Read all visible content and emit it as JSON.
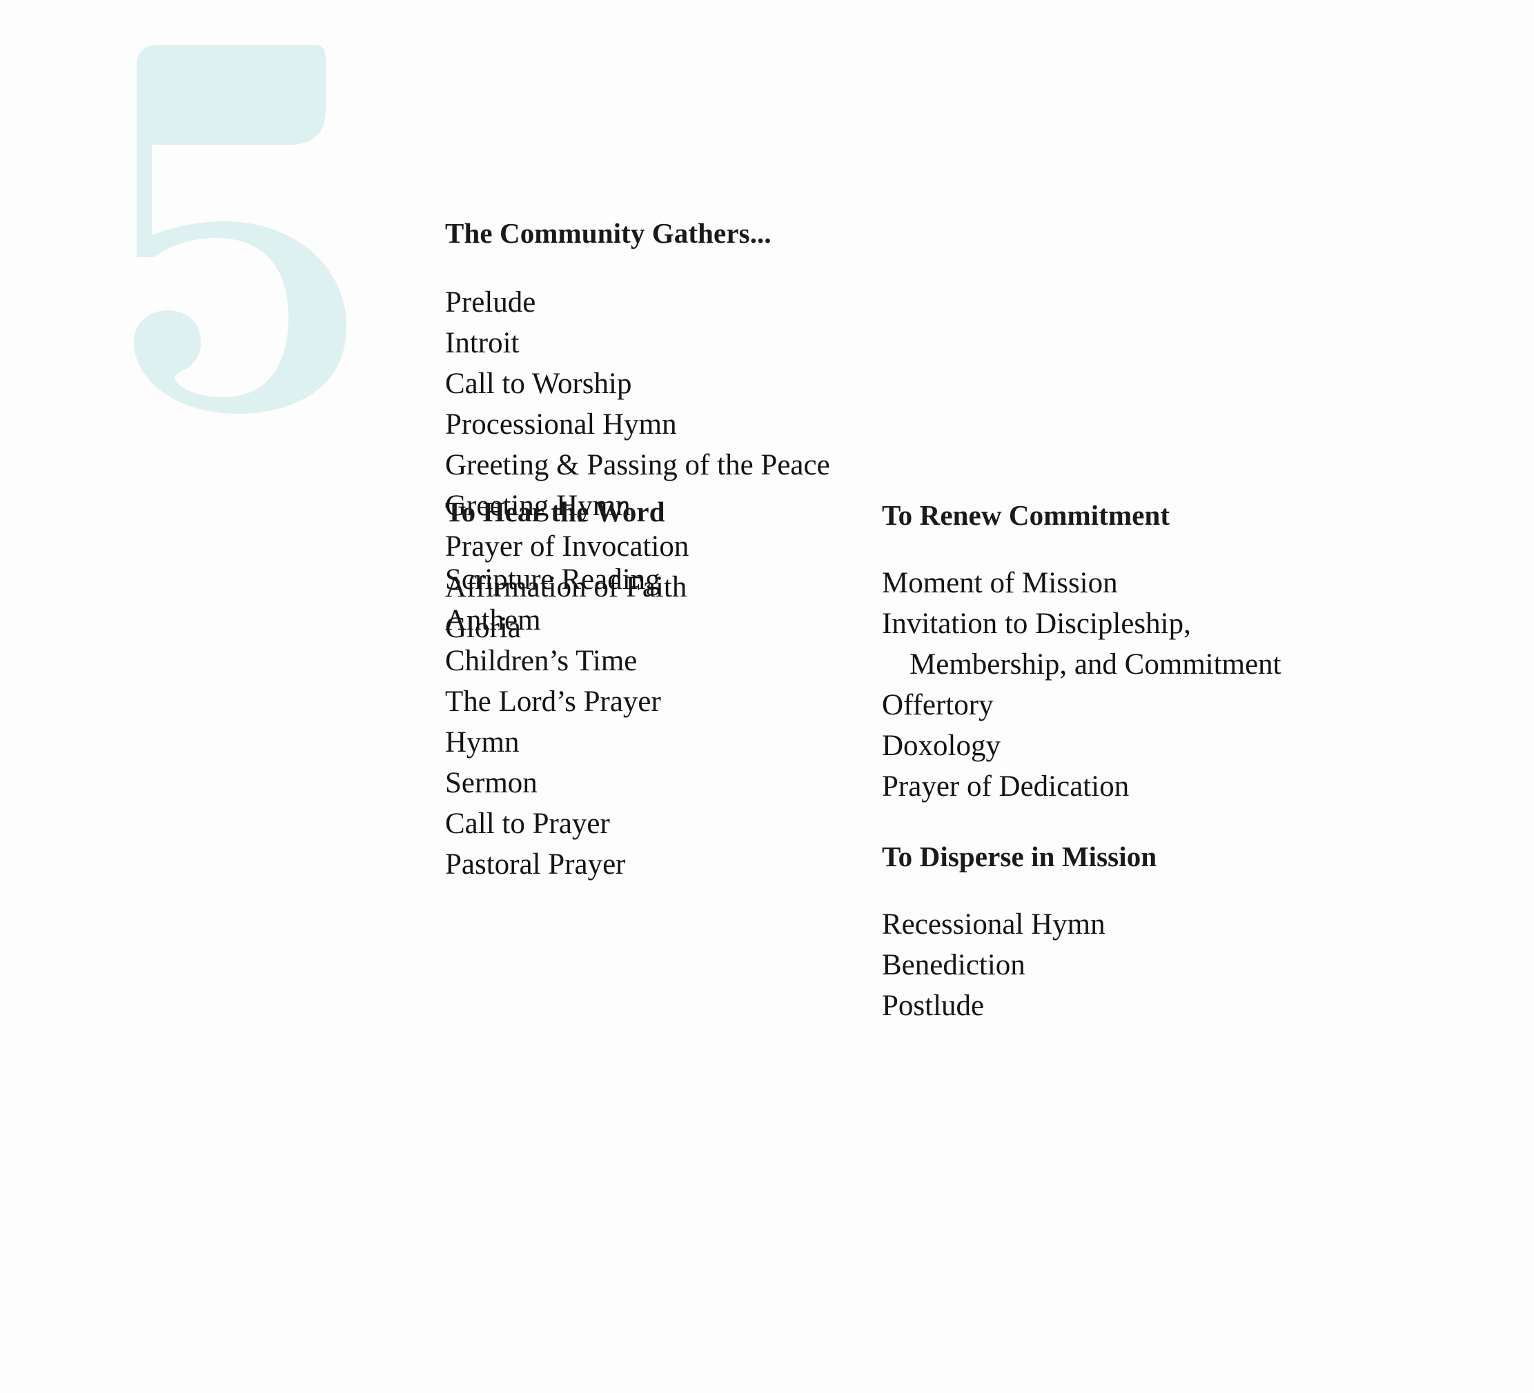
{
  "page": {
    "number": "5",
    "number_color": "#ddf1f0",
    "background_color": "#fdfdfd",
    "text_color": "#141414"
  },
  "sections": [
    {
      "heading": "The Community Gathers...",
      "items": [
        "Prelude",
        "Introit",
        "Call to Worship",
        "Processional Hymn",
        "Greeting & Passing of the Peace",
        "Greeting Hymn",
        "Prayer of Invocation",
        "Affirmation of Faith",
        "Gloria"
      ]
    },
    {
      "heading": "To Hear the Word",
      "items": [
        "Scripture Reading",
        "Anthem",
        "Children’s Time",
        "The Lord’s Prayer",
        "Hymn",
        "Sermon",
        "Call to Prayer",
        "Pastoral Prayer"
      ]
    },
    {
      "heading": "To Renew Commitment",
      "items": [
        "Moment of Mission",
        "Invitation to Discipleship,",
        "Membership, and Commitment",
        "Offertory",
        "Doxology",
        "Prayer of Dedication"
      ]
    },
    {
      "heading": "To Disperse in Mission",
      "items": [
        "Recessional Hymn",
        "Benediction",
        "Postlude"
      ]
    }
  ]
}
